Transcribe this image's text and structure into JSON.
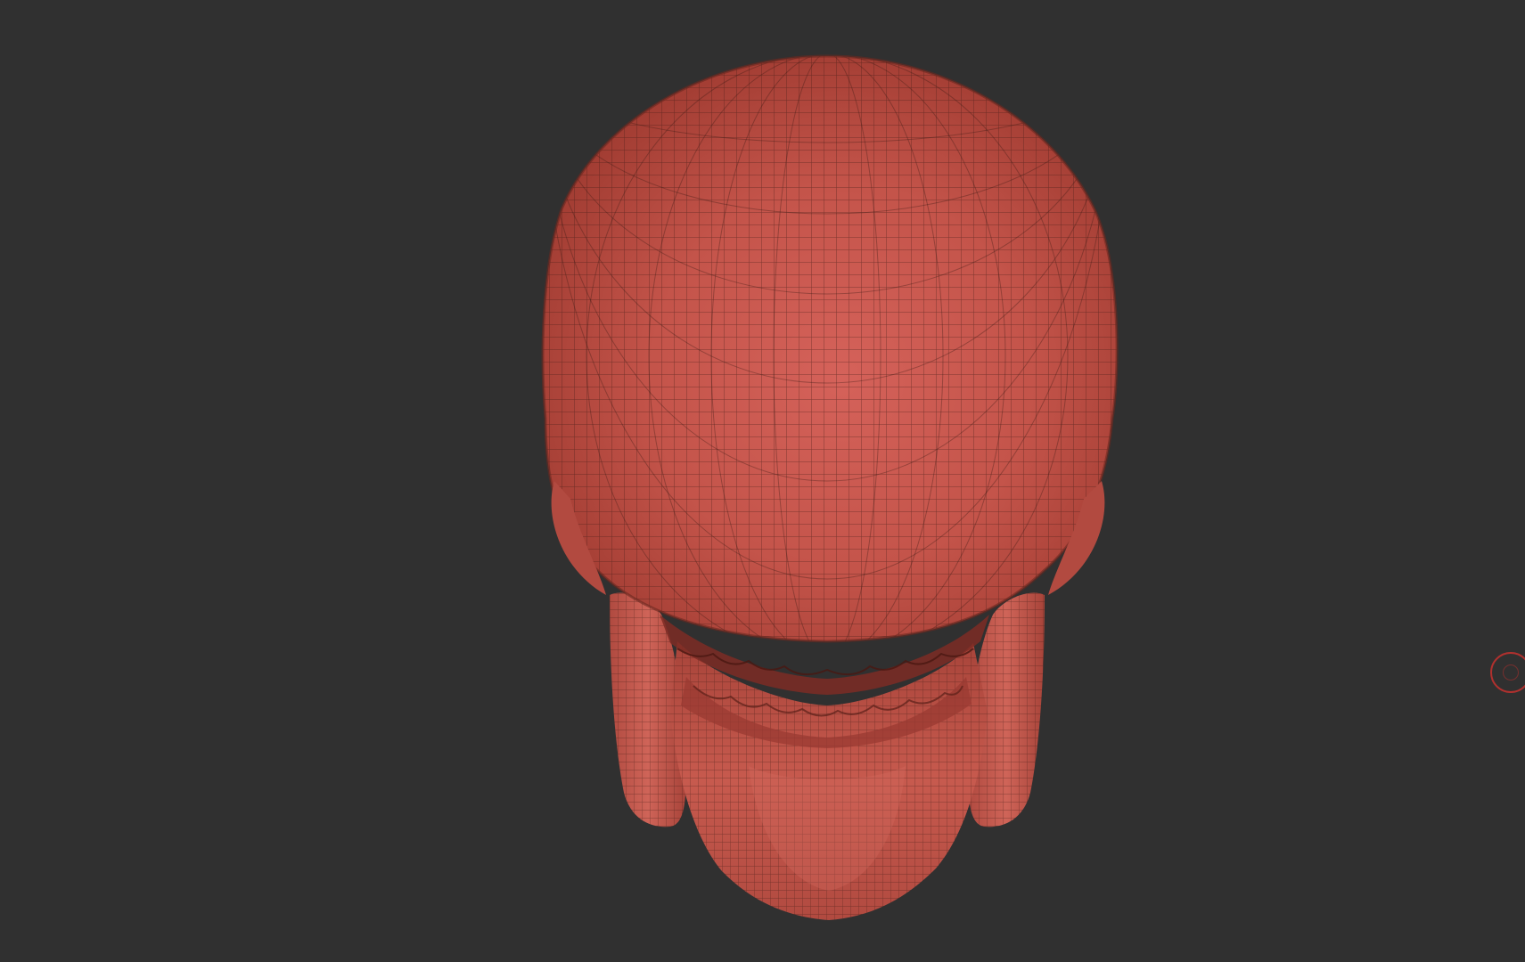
{
  "viewport": {
    "background": "#303030",
    "model_color": "#c9574a",
    "wire_color": "#3a1a14",
    "model_subject": "skull-icon"
  },
  "cursor": {
    "icon": "brush-cursor-icon",
    "color": "#b0302e"
  }
}
